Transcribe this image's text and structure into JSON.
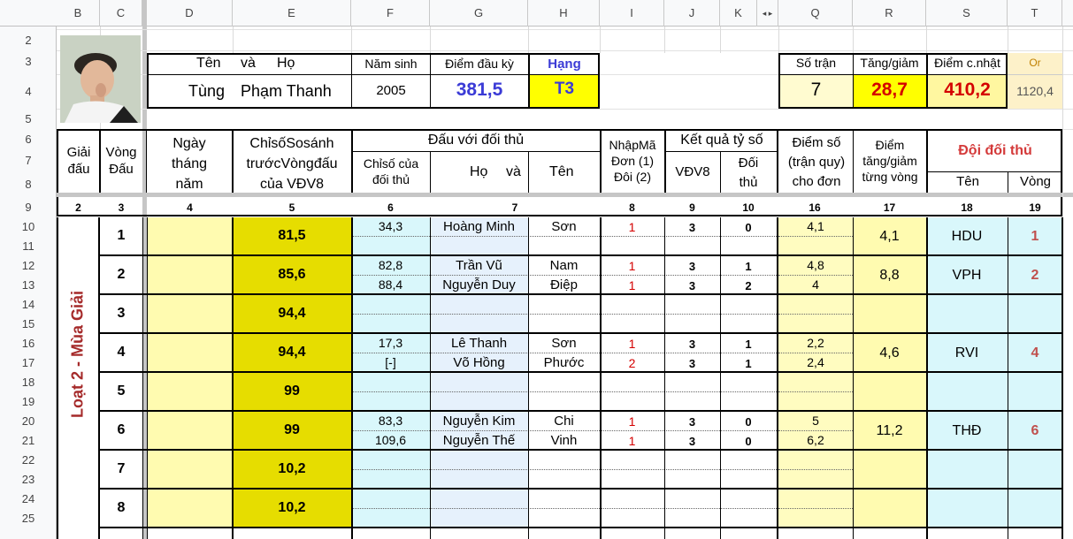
{
  "columns": [
    "B",
    "C",
    "D",
    "E",
    "F",
    "G",
    "H",
    "I",
    "J",
    "K",
    "Q",
    "R",
    "S",
    "T"
  ],
  "rows": [
    "2",
    "3",
    "4",
    "5",
    "6",
    "7",
    "8",
    "9",
    "10",
    "11",
    "12",
    "13",
    "14",
    "15",
    "16",
    "17",
    "18",
    "19",
    "20",
    "21",
    "22",
    "23",
    "24",
    "25"
  ],
  "athlete": {
    "h_name": "Tên",
    "h_and": "và",
    "h_surname": "Họ",
    "first_name": "Tùng",
    "last_name": "Phạm Thanh",
    "h_birth": "Năm sinh",
    "birth_year": "2005",
    "h_start": "Điểm đầu kỳ",
    "start_points": "381,5",
    "h_rank": "Hạng",
    "rank": "T3"
  },
  "summary": {
    "h_matches": "Số trận",
    "matches": "7",
    "h_change": "Tăng/giảm",
    "change": "28,7",
    "h_updated": "Điểm c.nhật",
    "updated": "410,2",
    "h_or": "Or",
    "or_value": "1120,4"
  },
  "headers": {
    "tournament": "Giải đấu",
    "round": "Vòng Đấu",
    "date": "Ngày tháng năm",
    "index": "ChỉsốSosánh trướcVòngđấu của VĐV8",
    "opponent_group": "Đấu với đối thủ",
    "opp_index": "Chỉsố của đối thủ",
    "opp_surname": "Họ",
    "opp_and": "và",
    "opp_name": "Tên",
    "input_code": "NhậpMã Đơn (1) Đôi (2)",
    "result_group": "Kết quả tỷ số",
    "vdv8": "VĐV8",
    "opp": "Đối thủ",
    "points": "Điểm số (trận quy) cho đơn",
    "round_change": "Điểm tăng/giảm từng vòng",
    "opp_team": "Đội đối thủ",
    "team_name": "Tên",
    "team_round": "Vòng"
  },
  "colnums": [
    "2",
    "3",
    "4",
    "5",
    "6",
    "7",
    "8",
    "9",
    "10",
    "16",
    "17",
    "18",
    "19"
  ],
  "side_label": "Loạt 2 - Mùa Giải",
  "rounds": [
    {
      "round": "1",
      "index": "81,5",
      "change": "4,1",
      "team": "HDU",
      "team_round": "1",
      "opponents": [
        {
          "idx": "34,3",
          "surname": "Hoàng Minh",
          "name": "Sơn",
          "code": "1",
          "a": "3",
          "b": "0",
          "pts": "4,1"
        }
      ]
    },
    {
      "round": "2",
      "index": "85,6",
      "change": "8,8",
      "team": "VPH",
      "team_round": "2",
      "opponents": [
        {
          "idx": "82,8",
          "surname": "Trần Vũ",
          "name": "Nam",
          "code": "1",
          "a": "3",
          "b": "1",
          "pts": "4,8"
        },
        {
          "idx": "88,4",
          "surname": "Nguyễn Duy",
          "name": "Điệp",
          "code": "1",
          "a": "3",
          "b": "2",
          "pts": "4"
        }
      ]
    },
    {
      "round": "3",
      "index": "94,4",
      "change": "",
      "team": "",
      "team_round": "",
      "opponents": []
    },
    {
      "round": "4",
      "index": "94,4",
      "change": "4,6",
      "team": "RVI",
      "team_round": "4",
      "opponents": [
        {
          "idx": "17,3",
          "surname": "Lê Thanh",
          "name": "Sơn",
          "code": "1",
          "a": "3",
          "b": "1",
          "pts": "2,2"
        },
        {
          "idx": "[-]",
          "surname": "Võ Hồng",
          "name": "Phước",
          "code": "2",
          "a": "3",
          "b": "1",
          "pts": "2,4"
        }
      ]
    },
    {
      "round": "5",
      "index": "99",
      "change": "",
      "team": "",
      "team_round": "",
      "opponents": []
    },
    {
      "round": "6",
      "index": "99",
      "change": "11,2",
      "team": "THĐ",
      "team_round": "6",
      "opponents": [
        {
          "idx": "83,3",
          "surname": "Nguyễn Kim",
          "name": "Chi",
          "code": "1",
          "a": "3",
          "b": "0",
          "pts": "5"
        },
        {
          "idx": "109,6",
          "surname": "Nguyễn Thế",
          "name": "Vinh",
          "code": "1",
          "a": "3",
          "b": "0",
          "pts": "6,2"
        }
      ]
    },
    {
      "round": "7",
      "index": "10,2",
      "change": "",
      "team": "",
      "team_round": "",
      "opponents": []
    },
    {
      "round": "8",
      "index": "10,2",
      "change": "",
      "team": "",
      "team_round": "",
      "opponents": []
    }
  ],
  "colors": {
    "blue": "#3b3bd6",
    "red": "#d40000",
    "darkred": "#a52a2a",
    "yellow": "#ffff00",
    "bigyellow": "#e6dd00"
  }
}
